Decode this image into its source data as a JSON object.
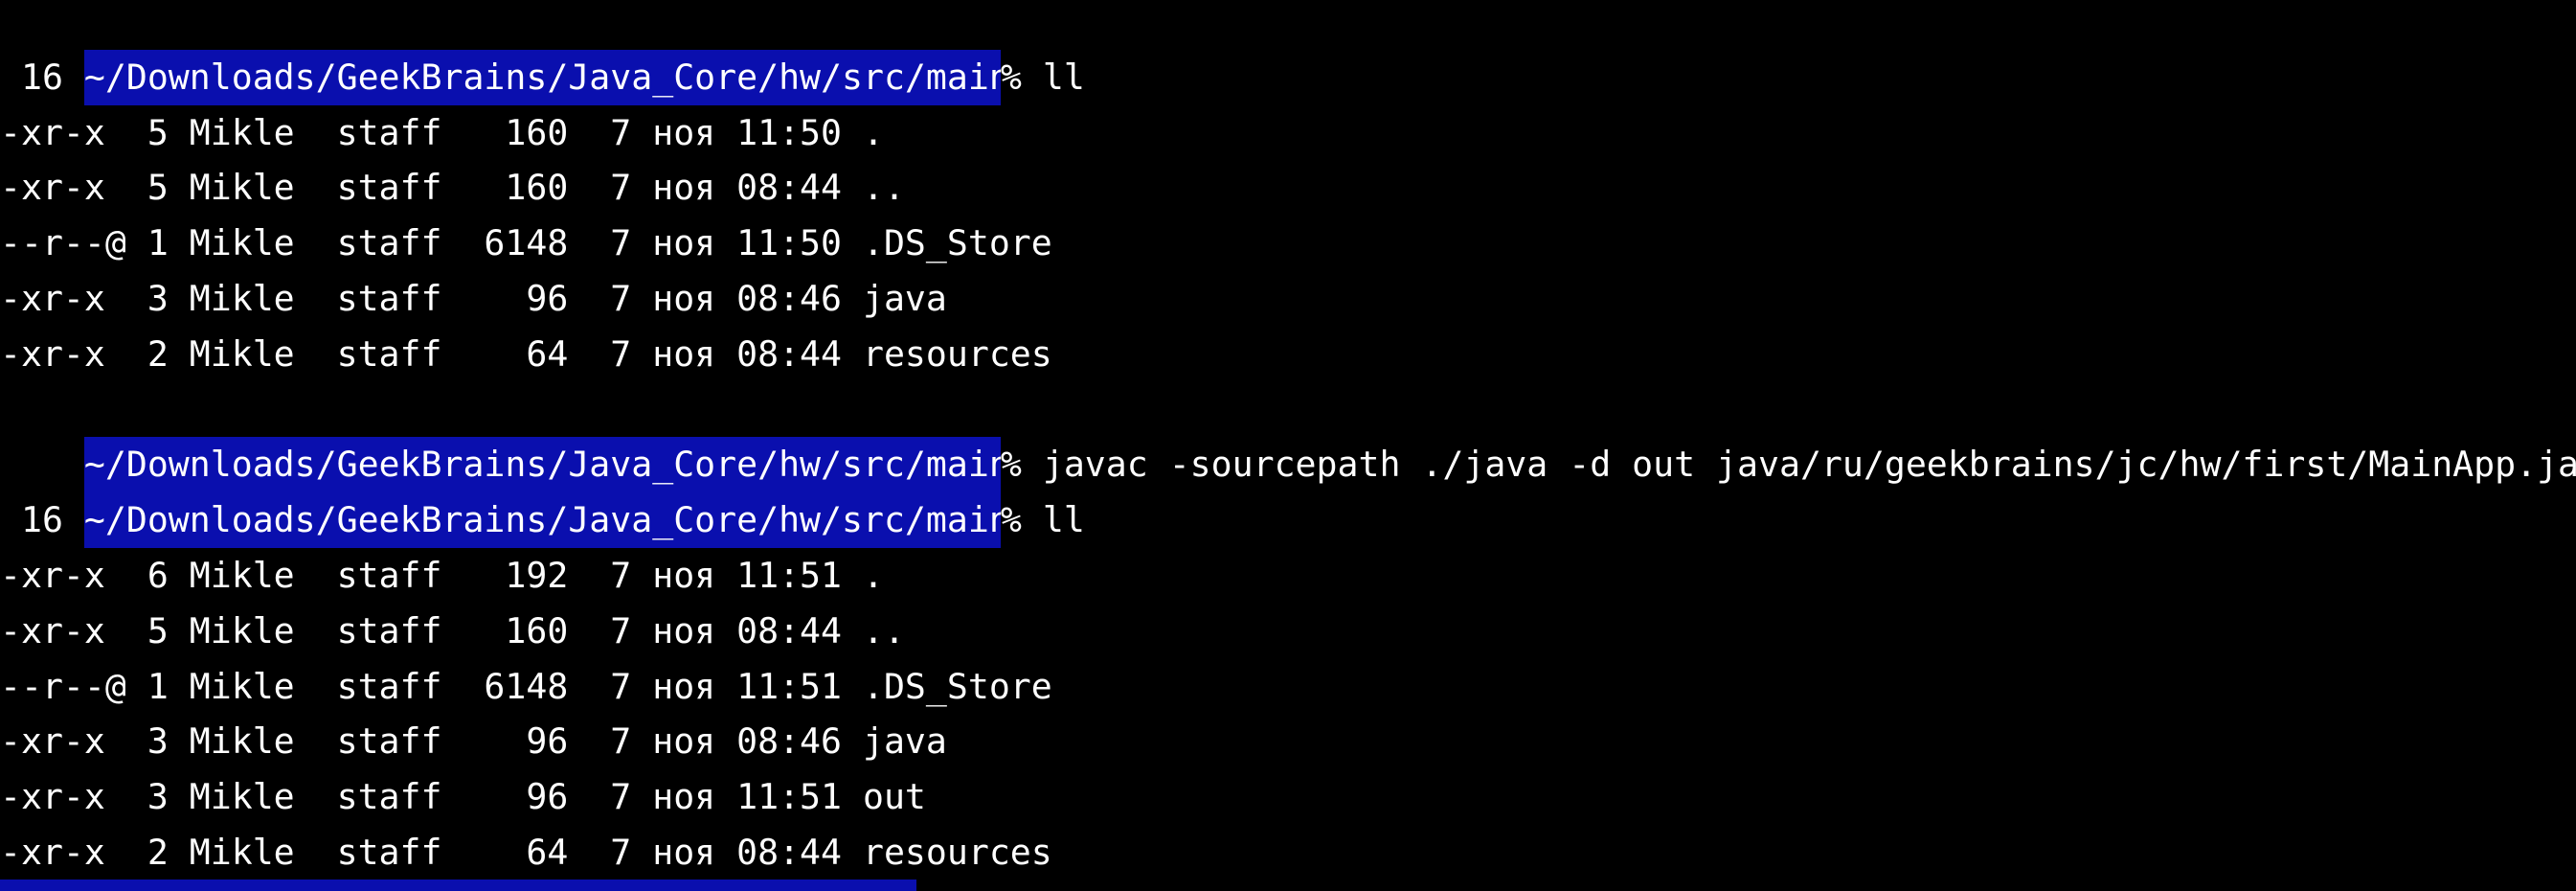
{
  "terminal": {
    "colors": {
      "background": "#000000",
      "foreground": "#ffffff",
      "prompt_highlight": "#0a0fae"
    },
    "lines": [
      {
        "type": "prompt",
        "path": "~/Downloads/GeekBrains/Java_Core/hw/src/main",
        "symbol": "% ",
        "command": "ll"
      },
      {
        "type": "output",
        "text": " 16"
      },
      {
        "type": "output",
        "text": "-xr-x  5 Mikle  staff   160  7 ноя 11:50 ."
      },
      {
        "type": "output",
        "text": "-xr-x  5 Mikle  staff   160  7 ноя 08:44 .."
      },
      {
        "type": "output",
        "text": "--r--@ 1 Mikle  staff  6148  7 ноя 11:50 .DS_Store"
      },
      {
        "type": "output",
        "text": "-xr-x  3 Mikle  staff    96  7 ноя 08:46 java"
      },
      {
        "type": "output",
        "text": "-xr-x  2 Mikle  staff    64  7 ноя 08:44 resources"
      },
      {
        "type": "prompt",
        "path": "~/Downloads/GeekBrains/Java_Core/hw/src/main",
        "symbol": "% ",
        "command": "javac -sourcepath ./java -d out java/ru/geekbrains/jc/hw/first/MainApp.java"
      },
      {
        "type": "prompt",
        "path": "~/Downloads/GeekBrains/Java_Core/hw/src/main",
        "symbol": "% ",
        "command": "ll"
      },
      {
        "type": "output",
        "text": " 16"
      },
      {
        "type": "output",
        "text": "-xr-x  6 Mikle  staff   192  7 ноя 11:51 ."
      },
      {
        "type": "output",
        "text": "-xr-x  5 Mikle  staff   160  7 ноя 08:44 .."
      },
      {
        "type": "output",
        "text": "--r--@ 1 Mikle  staff  6148  7 ноя 11:51 .DS_Store"
      },
      {
        "type": "output",
        "text": "-xr-x  3 Mikle  staff    96  7 ноя 08:46 java"
      },
      {
        "type": "output",
        "text": "-xr-x  3 Mikle  staff    96  7 ноя 11:51 out"
      },
      {
        "type": "output",
        "text": "-xr-x  2 Mikle  staff    64  7 ноя 08:44 resources"
      }
    ]
  }
}
